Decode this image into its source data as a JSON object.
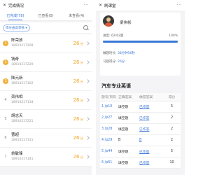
{
  "left": {
    "title": "完成情况",
    "more": "···",
    "tabs": [
      {
        "label": "已完成(78)"
      },
      {
        "label": "已查看(0)"
      },
      {
        "label": "未查看(4)"
      }
    ],
    "sort_label": "得分由高到低 ▾",
    "students": [
      {
        "rank": "1",
        "name": "陈荣放",
        "id": "18910217208",
        "score": "26",
        "unit": "分"
      },
      {
        "rank": "2",
        "name": "钱奇",
        "id": "18910217229",
        "score": "26",
        "unit": "分"
      },
      {
        "rank": "3",
        "name": "陆元新",
        "id": "18910217102",
        "score": "26",
        "unit": "分"
      },
      {
        "rank": "4",
        "name": "栾伟相",
        "id": "18910217134",
        "score": "26",
        "unit": "分"
      },
      {
        "rank": "5",
        "name": "胡志天",
        "id": "18910217221",
        "score": "26",
        "unit": "分"
      },
      {
        "rank": "6",
        "name": "曹超",
        "id": "18910217311",
        "score": "26",
        "unit": "分"
      },
      {
        "rank": "7",
        "name": "俞敏锋",
        "id": "18910217341",
        "score": "26",
        "unit": "分"
      }
    ]
  },
  "right": {
    "title": "刷课堂",
    "more": "···",
    "user_name": "梁伟彬",
    "progress_label": "进度: 62/62题",
    "progress_pct": "100%",
    "progress_value": 1.0,
    "duration_label": "做题时长: ",
    "duration_value": "38分钟56秒",
    "accuracy_label": "习题得分: ",
    "accuracy_value": "26分",
    "section_title": "汽车专业英语",
    "table_headers": [
      "题号/页码",
      "正确答案",
      "做答答案",
      "得分"
    ],
    "table_rows": [
      {
        "page": "1 /p10",
        "answer": "填空题",
        "mine": "已作答",
        "score": "5"
      },
      {
        "page": "2 /p27",
        "answer": "填空题",
        "mine": "已作答",
        "score": "2"
      },
      {
        "page": "3 /p28",
        "answer": "填空题",
        "mine": "已作答",
        "score": "2"
      },
      {
        "page": "4 /p29",
        "answer": "B",
        "mine": "B",
        "score": "2"
      },
      {
        "page": "5 /p44",
        "answer": "填空题",
        "mine": "已作答",
        "score": "5"
      },
      {
        "page": "6 /p61",
        "answer": "填空题",
        "mine": "已作答",
        "score": "10"
      }
    ]
  },
  "colors": {
    "accent": "#3a78d8",
    "score": "#f5a623",
    "medal": "#f0b23c"
  }
}
